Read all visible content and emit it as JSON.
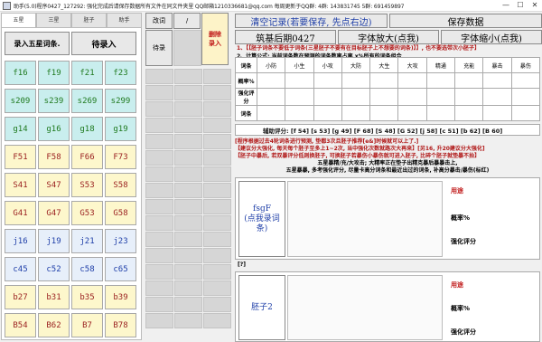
{
  "window": {
    "title": "助手(5.0)程序0427_127292: 强化完成后请保存数据所有文件在同文件夹里 QQ邮箱1210336681@qq.com 每周更新于QQ群: 4群: 143831745 5群: 691459897",
    "controls": [
      "—",
      "☐",
      "✕"
    ]
  },
  "left": {
    "tabs": [
      "五星",
      "三星",
      "胚子",
      "助手"
    ],
    "enter_btn": "录入五星词条.",
    "pending_btn": "待录入",
    "cells": [
      {
        "text": "f16",
        "style": "teal"
      },
      {
        "text": "f19",
        "style": "teal"
      },
      {
        "text": "f21",
        "style": "teal"
      },
      {
        "text": "f23",
        "style": "teal"
      },
      {
        "text": "s209",
        "style": "teal"
      },
      {
        "text": "s239",
        "style": "teal"
      },
      {
        "text": "s269",
        "style": "teal"
      },
      {
        "text": "s299",
        "style": "teal"
      },
      {
        "text": "g14",
        "style": "teal"
      },
      {
        "text": "g16",
        "style": "teal"
      },
      {
        "text": "g18",
        "style": "teal"
      },
      {
        "text": "g19",
        "style": "teal"
      },
      {
        "text": "F51",
        "style": "cream"
      },
      {
        "text": "F58",
        "style": "cream"
      },
      {
        "text": "F66",
        "style": "cream"
      },
      {
        "text": "F73",
        "style": "cream"
      },
      {
        "text": "S41",
        "style": "cream"
      },
      {
        "text": "S47",
        "style": "cream"
      },
      {
        "text": "S53",
        "style": "cream"
      },
      {
        "text": "S58",
        "style": "cream"
      },
      {
        "text": "G41",
        "style": "cream"
      },
      {
        "text": "G47",
        "style": "cream"
      },
      {
        "text": "G53",
        "style": "cream"
      },
      {
        "text": "G58",
        "style": "cream"
      },
      {
        "text": "j16",
        "style": "blue"
      },
      {
        "text": "j19",
        "style": "blue"
      },
      {
        "text": "j21",
        "style": "blue"
      },
      {
        "text": "j23",
        "style": "blue"
      },
      {
        "text": "c45",
        "style": "blue"
      },
      {
        "text": "c52",
        "style": "blue"
      },
      {
        "text": "c58",
        "style": "blue"
      },
      {
        "text": "c65",
        "style": "blue"
      },
      {
        "text": "b27",
        "style": "cream"
      },
      {
        "text": "b31",
        "style": "cream"
      },
      {
        "text": "b35",
        "style": "cream"
      },
      {
        "text": "b39",
        "style": "cream"
      },
      {
        "text": "B54",
        "style": "cream"
      },
      {
        "text": "B62",
        "style": "cream"
      },
      {
        "text": "B7",
        "style": "cream"
      },
      {
        "text": "B78",
        "style": "cream"
      }
    ]
  },
  "mid": {
    "b1": "改词",
    "b2": "/",
    "pending": "待录",
    "delete": "删除\n录入"
  },
  "right": {
    "clear_btn": "清空记录(若要保存, 先点右边)",
    "save_btn": "保存数据",
    "build_btn": "筑基后期0427",
    "zoom_in": "字体放大(点我)",
    "zoom_out": "字体缩小(点我)",
    "note1": "1、【【胚子词条不要低于词条(三星胚子不要有在目标胚子上不想要的词条)】】, 也不要选带次小胚子】",
    "note2": "2、计算公式: 当前词条数在预测的词条数率占率  x%所有的词条组合",
    "table_header": [
      "词条",
      "小防",
      "小生",
      "小攻",
      "大防",
      "大生",
      "大攻",
      "精通",
      "充能",
      "暴击",
      "暴伤"
    ],
    "row_labels": [
      "概率%",
      "强化评分",
      "词条"
    ],
    "assist": "辅助评分: [f 54] [s 53] [g 49] [F 68] [S 48] [G 52] [j 58] [c 51] [b 62] [B 60]",
    "tip1": "[程序根据过去4轮词条进行预测, 垫都3次且胚子推荐[e&]时候就可以上了.]",
    "tip2": "【建议分大强化, 每天每个胚子至多上1~2次, 当中强化次数就路次大再来】[另16, 升20建议分大强化]",
    "tip3": "【胚子中暴后, 若双暴评分低则换胚子, 可换胚子若暴伤小暴伤就可进入胚子, 比碎个胚子就垫暴不抬】",
    "tip4": "五星暴精/充/大攻击; 大精率正在垫子出精克暴后暴暴击上,",
    "tip5": "五星暴暴, 多考强化评分, 尽量卡高分词条和最近出过的词条, 补高分暴击/暴伤(标红)",
    "card1": {
      "btn": "fsgF\n(点我录词条)",
      "use": "用途",
      "prob": "概率%",
      "score": "强化评分",
      "mark": "[?]"
    },
    "card2": {
      "btn": "胚子2",
      "use": "用途",
      "prob": "概率%",
      "score": "强化评分",
      "mark": "[?]"
    }
  }
}
